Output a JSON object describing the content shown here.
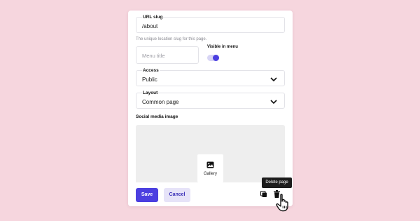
{
  "form": {
    "url_slug": {
      "label": "URL slug",
      "value": "/about",
      "help": "The unique location slug for this page."
    },
    "menu_title": {
      "placeholder": "Menu title"
    },
    "visible_in_menu": {
      "label": "Visible in menu",
      "on": true
    },
    "access": {
      "label": "Access",
      "value": "Public"
    },
    "layout": {
      "label": "Layout",
      "value": "Common page"
    },
    "social_image": {
      "title": "Social media image",
      "gallery_label": "Gallery"
    }
  },
  "footer": {
    "save_label": "Save",
    "cancel_label": "Cancel",
    "delete_tooltip": "Delete page"
  },
  "colors": {
    "background": "#f6d6de",
    "accent": "#4b3fe0",
    "accent_soft": "#e6e3f8"
  },
  "icons": [
    "chevron-down-icon",
    "image-icon",
    "duplicate-icon",
    "trash-icon",
    "hand-cursor-icon"
  ]
}
